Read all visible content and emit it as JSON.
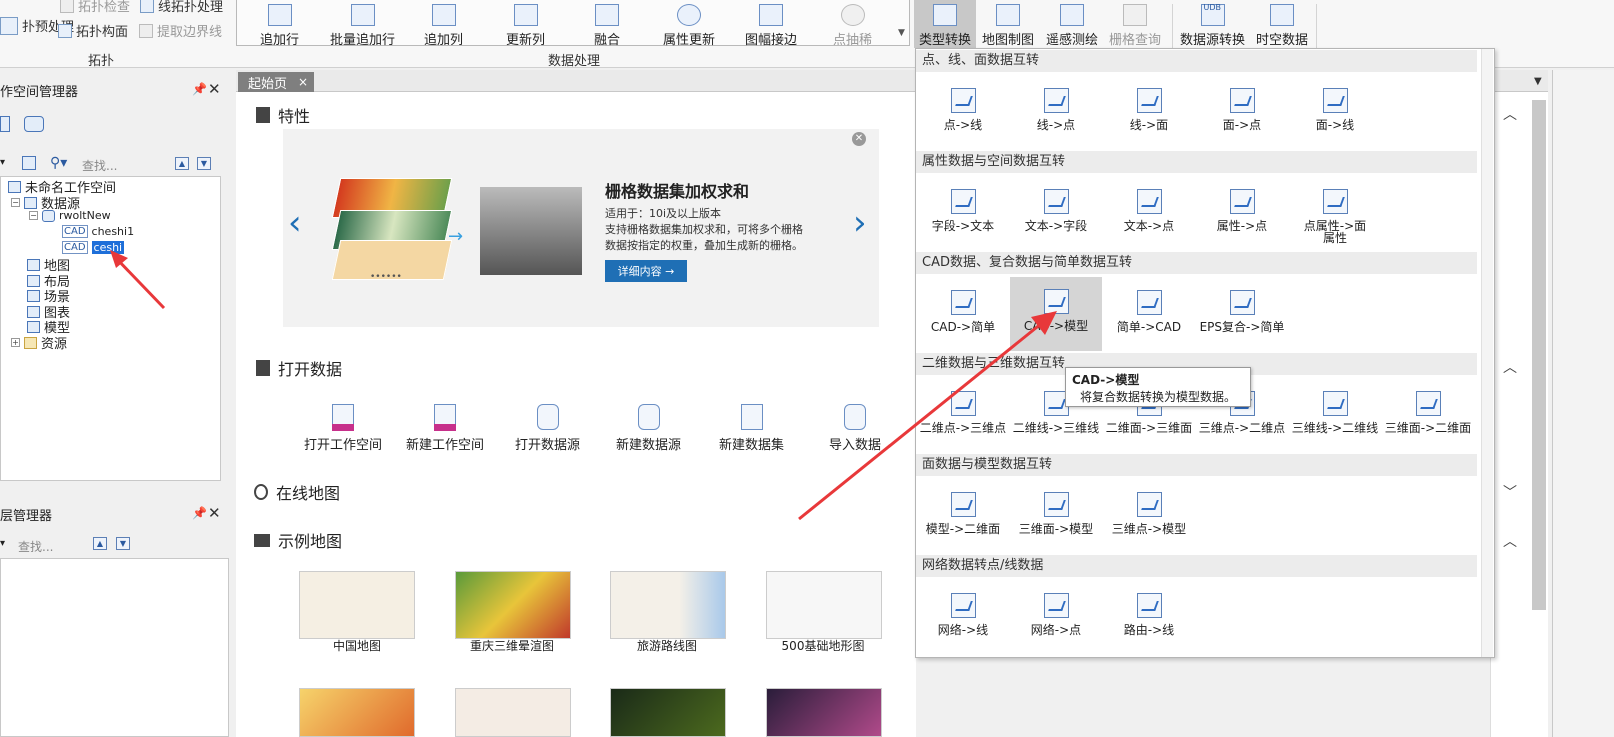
{
  "ribbon": {
    "topology_small": [
      {
        "label": "扑预处理"
      },
      {
        "label": "拓扑检查",
        "disabled": true
      },
      {
        "label": "线拓扑处理"
      },
      {
        "label": "拓扑构面"
      },
      {
        "label": "提取边界线",
        "disabled": true
      }
    ],
    "topology_group": "拓扑",
    "data_process_buttons": [
      "追加行",
      "批量追加行",
      "追加列",
      "更新列",
      "融合",
      "属性更新",
      "图幅接边",
      "点抽稀"
    ],
    "data_process_group": "数据处理",
    "right_tabs": [
      "类型转换",
      "地图制图",
      "遥感测绘",
      "栅格查询",
      "数据源转换",
      "时空数据"
    ],
    "udb": "UDB"
  },
  "workspace_panel": {
    "title": "作空间管理器",
    "search_placeholder": "查找...",
    "tree": {
      "root": "未命名工作空间",
      "datasources": "数据源",
      "ds": "rwoltNew",
      "cad1": "cheshi1",
      "cad2": "ceshi",
      "cad_tag": "CAD",
      "items": [
        "地图",
        "布局",
        "场景",
        "图表",
        "模型",
        "资源"
      ]
    }
  },
  "layer_panel": {
    "title": "层管理器",
    "search_placeholder": "查找..."
  },
  "doc_tab": {
    "label": "起始页",
    "close": "×"
  },
  "start_page": {
    "features_title": "特性",
    "banner": {
      "title": "栅格数据集加权求和",
      "line1": "适用于：10i及以上版本",
      "line2": "支持栅格数据集加权求和，可将多个栅格",
      "line3": "数据按指定的权重，叠加生成新的栅格。",
      "button": "详细内容 →",
      "dots": "••••••"
    },
    "open_data_title": "打开数据",
    "open_buttons": [
      "打开工作空间",
      "新建工作空间",
      "打开数据源",
      "新建数据源",
      "新建数据集",
      "导入数据"
    ],
    "online_map_title": "在线地图",
    "sample_map_title": "示例地图",
    "sample_maps": [
      "中国地图",
      "重庆三维晕渲图",
      "旅游路线图",
      "500基础地形图"
    ]
  },
  "dropdown": {
    "sections": [
      {
        "title": "点、线、面数据互转",
        "items": [
          "点->线",
          "线->点",
          "线->面",
          "面->点",
          "面->线"
        ]
      },
      {
        "title": "属性数据与空间数据互转",
        "items": [
          "字段->文本",
          "文本->字段",
          "文本->点",
          "属性->点",
          "点属性->面属性"
        ]
      },
      {
        "title": "CAD数据、复合数据与简单数据互转",
        "items": [
          "CAD->简单",
          "CAD->模型",
          "简单->CAD",
          "EPS复合->简单"
        ]
      },
      {
        "title": "二维数据与三维数据互转",
        "items": [
          "二维点->三维点",
          "二维线->三维线",
          "二维面->三维面",
          "三维点->二维点",
          "三维线->二维线",
          "三维面->二维面"
        ]
      },
      {
        "title": "面数据与模型数据互转",
        "items": [
          "模型->二维面",
          "三维面->模型",
          "三维点->模型"
        ]
      },
      {
        "title": "网络数据转点/线数据",
        "items": [
          "网络->线",
          "网络->点",
          "路由->线"
        ]
      }
    ],
    "tooltip": {
      "title_a": "CAD->",
      "title_b": "模型",
      "desc": "将复合数据转换为模型数据。"
    }
  },
  "colors": {
    "accent": "#1f6fb5",
    "arrow": "#e8383a",
    "selection": "#1e6fd9"
  }
}
